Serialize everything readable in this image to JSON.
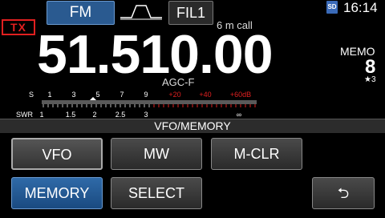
{
  "status": {
    "tx": "TX",
    "mode": "FM",
    "filter": "FIL1",
    "memo_name": "6 m call",
    "sd": "SD",
    "clock": "16:14"
  },
  "main": {
    "frequency": "51.510.00",
    "agc": "AGC-F"
  },
  "memo": {
    "label": "MEMO",
    "channel": "8",
    "star": "★3"
  },
  "meter": {
    "s_label": "S",
    "s_ticks": [
      "1",
      "3",
      "5",
      "7",
      "9",
      "+20",
      "+40",
      "+60dB"
    ],
    "swr_label": "SWR",
    "swr_ticks": [
      "1",
      "1.5",
      "2",
      "2.5",
      "3",
      "∞"
    ],
    "color_normal": "#ffffff",
    "color_over": "#e02020"
  },
  "panel": {
    "title": "VFO/MEMORY",
    "buttons": {
      "vfo": "VFO",
      "mw": "MW",
      "mclr": "M-CLR",
      "memory": "MEMORY",
      "select": "SELECT",
      "back": "⮌"
    }
  },
  "colors": {
    "accent_blue": "#2a5a90",
    "tx_red": "#e02020"
  }
}
